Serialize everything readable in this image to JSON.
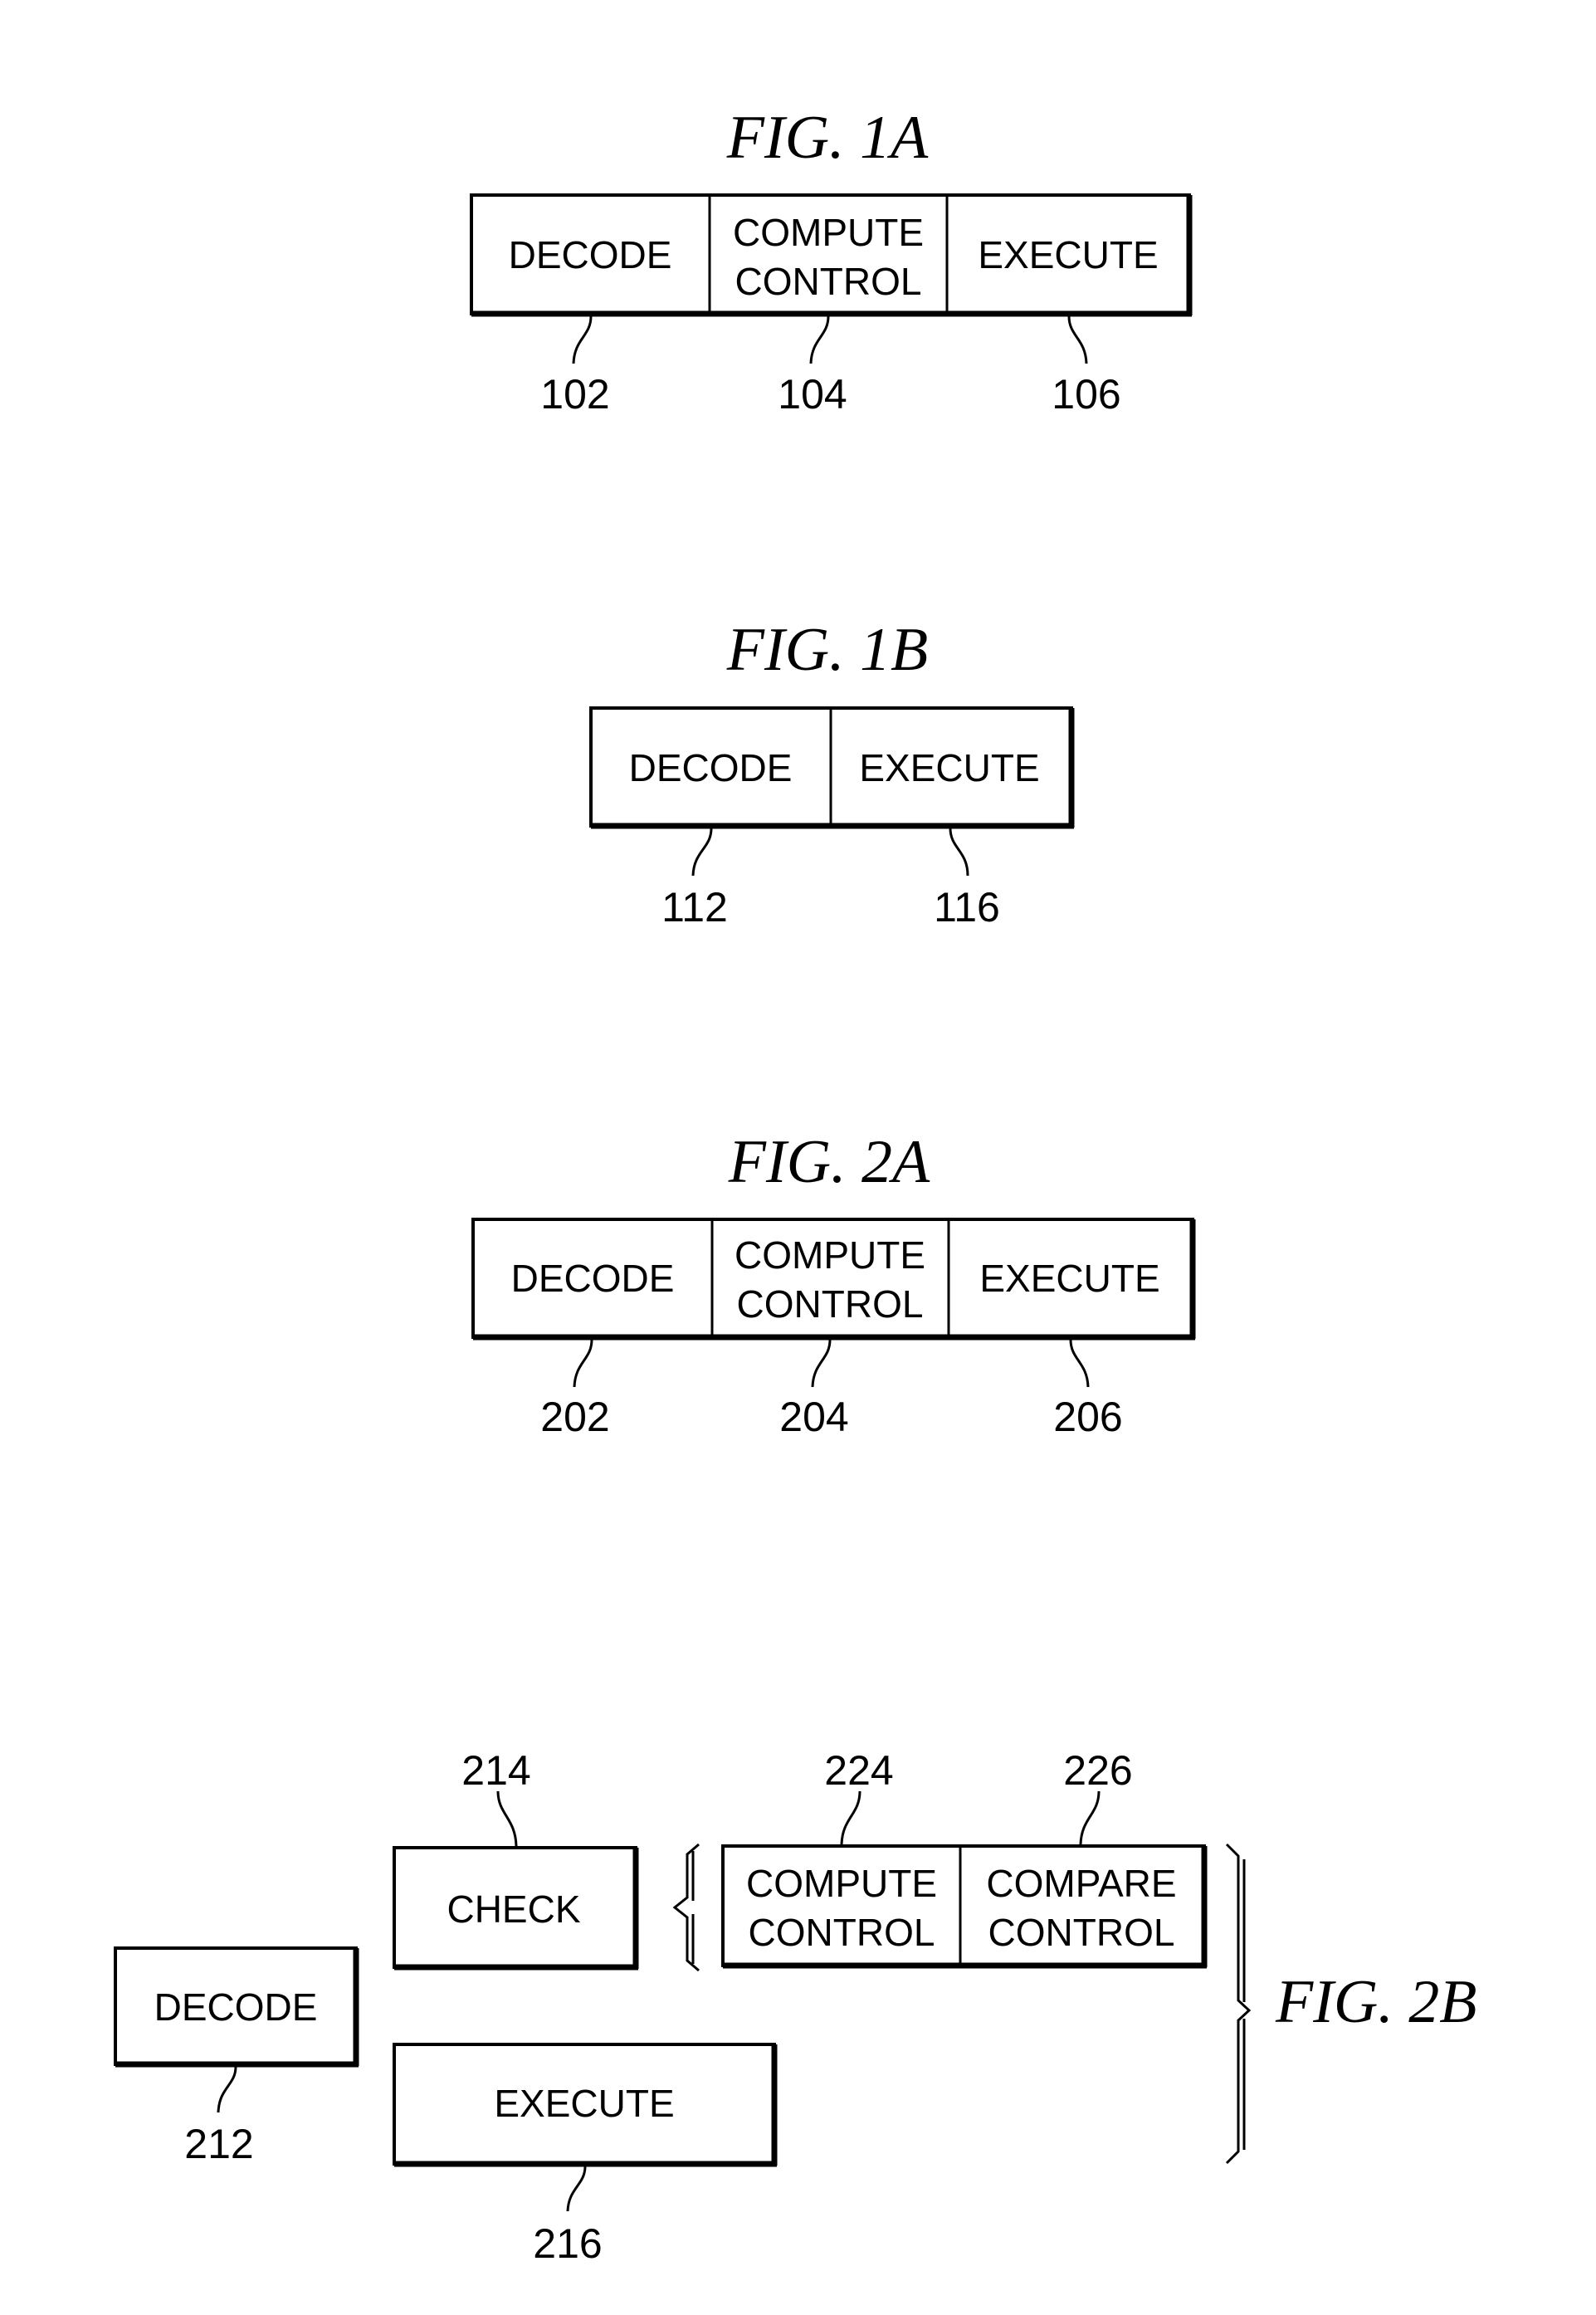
{
  "figures": {
    "fig1a": {
      "title": "FIG. 1A",
      "stages": [
        {
          "lines": [
            "DECODE"
          ],
          "ref": "102"
        },
        {
          "lines": [
            "COMPUTE",
            "CONTROL"
          ],
          "ref": "104"
        },
        {
          "lines": [
            "EXECUTE"
          ],
          "ref": "106"
        }
      ]
    },
    "fig1b": {
      "title": "FIG. 1B",
      "stages": [
        {
          "lines": [
            "DECODE"
          ],
          "ref": "112"
        },
        {
          "lines": [
            "EXECUTE"
          ],
          "ref": "116"
        }
      ]
    },
    "fig2a": {
      "title": "FIG. 2A",
      "stages": [
        {
          "lines": [
            "DECODE"
          ],
          "ref": "202"
        },
        {
          "lines": [
            "COMPUTE",
            "CONTROL"
          ],
          "ref": "204"
        },
        {
          "lines": [
            "EXECUTE"
          ],
          "ref": "206"
        }
      ]
    },
    "fig2b": {
      "title": "FIG. 2B",
      "decode": {
        "lines": [
          "DECODE"
        ],
        "ref": "212"
      },
      "check": {
        "lines": [
          "CHECK"
        ],
        "ref": "214"
      },
      "execute": {
        "lines": [
          "EXECUTE"
        ],
        "ref": "216"
      },
      "compute_control": {
        "lines": [
          "COMPUTE",
          "CONTROL"
        ],
        "ref": "224"
      },
      "compare_control": {
        "lines": [
          "COMPARE",
          "CONTROL"
        ],
        "ref": "226"
      }
    }
  }
}
